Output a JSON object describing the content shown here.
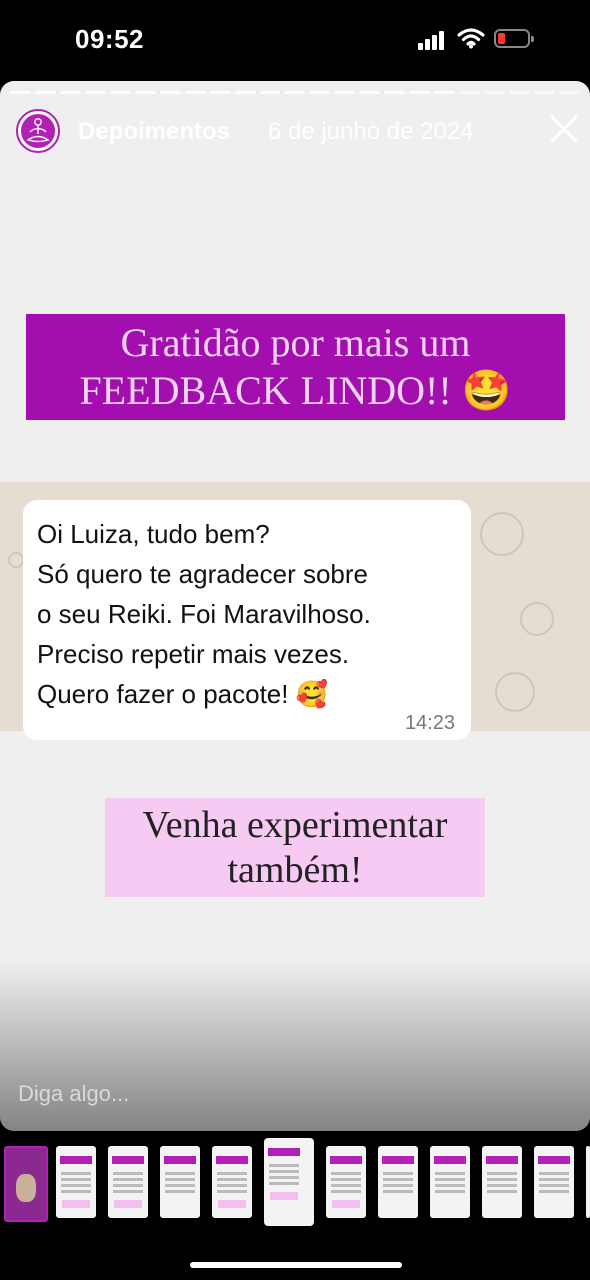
{
  "status": {
    "time": "09:52"
  },
  "story": {
    "username": "Depoimentos",
    "date": "6 de junho de 2024",
    "banner_top": "Gratidão por mais um\nFEEDBACK LINDO!! 🤩",
    "message": "Oi Luiza, tudo bem?\nSó quero te agradecer sobre\no seu Reiki. Foi Maravilhoso.\nPreciso repetir mais vezes.\nQuero fazer o pacote! 🥰",
    "message_time": "14:23",
    "banner_bottom": "Venha experimentar\ntambém!",
    "reply_placeholder": "Diga algo..."
  },
  "icons": {
    "avatar": "meditation-figure-icon",
    "close": "close-icon",
    "signal": "cellular-signal-icon",
    "wifi": "wifi-icon",
    "battery": "battery-low-icon"
  },
  "colors": {
    "brand_purple": "#a30fae",
    "brand_pink": "#f7caf4",
    "chat_bg": "#e6ddd2",
    "battery_low": "#ff3b30"
  },
  "thumbnails_count": 12,
  "active_thumbnail_index": 5
}
